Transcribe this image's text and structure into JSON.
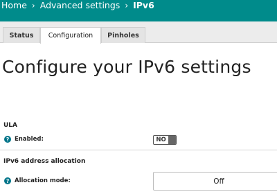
{
  "breadcrumb": {
    "home": "Home",
    "advanced": "Advanced settings",
    "current": "IPv6"
  },
  "tabs": [
    {
      "label": "Status"
    },
    {
      "label": "Configuration"
    },
    {
      "label": "Pinholes"
    }
  ],
  "active_tab": "Configuration",
  "page_title": "Configure your IPv6 settings",
  "ula": {
    "section_title": "ULA",
    "enabled_label": "Enabled:",
    "enabled_value": "NO"
  },
  "allocation": {
    "section_title": "IPv6 address allocation",
    "mode_label": "Allocation mode:",
    "mode_value": "Off"
  },
  "help_glyph": "?",
  "colors": {
    "header_bg": "#008b8b",
    "help_icon": "#00758a"
  }
}
